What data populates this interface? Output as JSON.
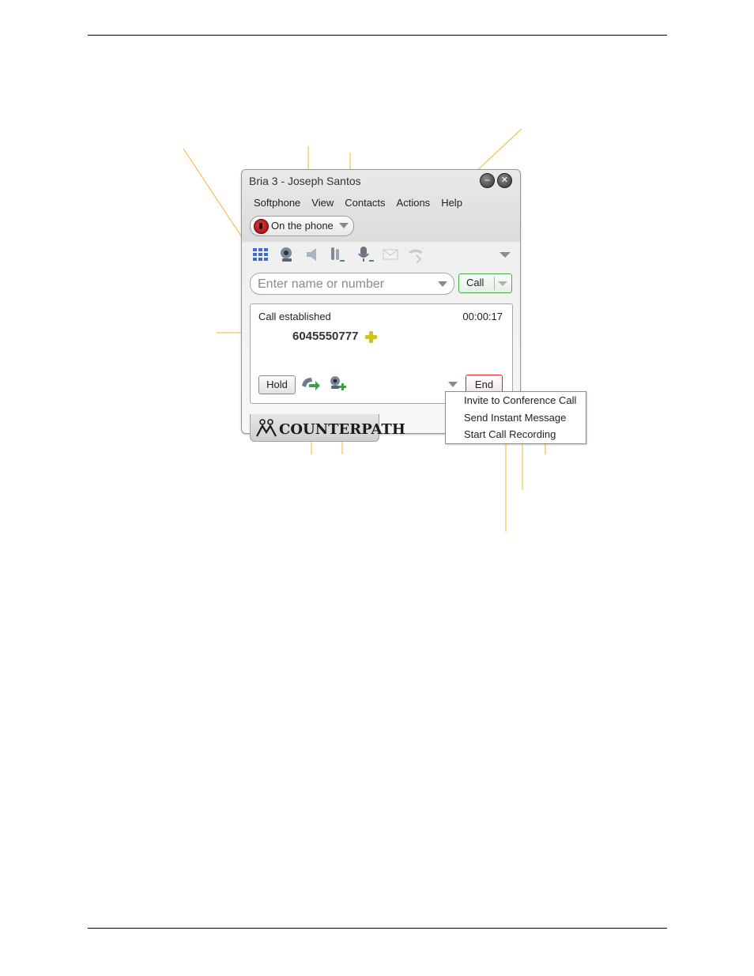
{
  "window": {
    "title": "Bria 3 - Joseph Santos"
  },
  "menu": [
    "Softphone",
    "View",
    "Contacts",
    "Actions",
    "Help"
  ],
  "status": {
    "label": "On the phone"
  },
  "toolbar": {
    "icons": [
      "dialpad-icon",
      "video-icon",
      "speaker-icon",
      "mic-volume-icon",
      "microphone-icon",
      "message-icon",
      "transfer-icon"
    ]
  },
  "dial": {
    "placeholder": "Enter name or number"
  },
  "call_button": {
    "label": "Call"
  },
  "call": {
    "status": "Call established",
    "timer": "00:00:17",
    "number": "6045550777",
    "hold_label": "Hold",
    "end_label": "End"
  },
  "logo": {
    "text": "COUNTERPATH"
  },
  "context_menu": {
    "items": [
      "Invite to Conference Call",
      "Send Instant Message",
      "Start Call Recording"
    ]
  },
  "colors": {
    "callout": "#f3b728",
    "end_border": "#dd2222",
    "call_border": "#49b049",
    "status_red": "#d42a2a"
  }
}
